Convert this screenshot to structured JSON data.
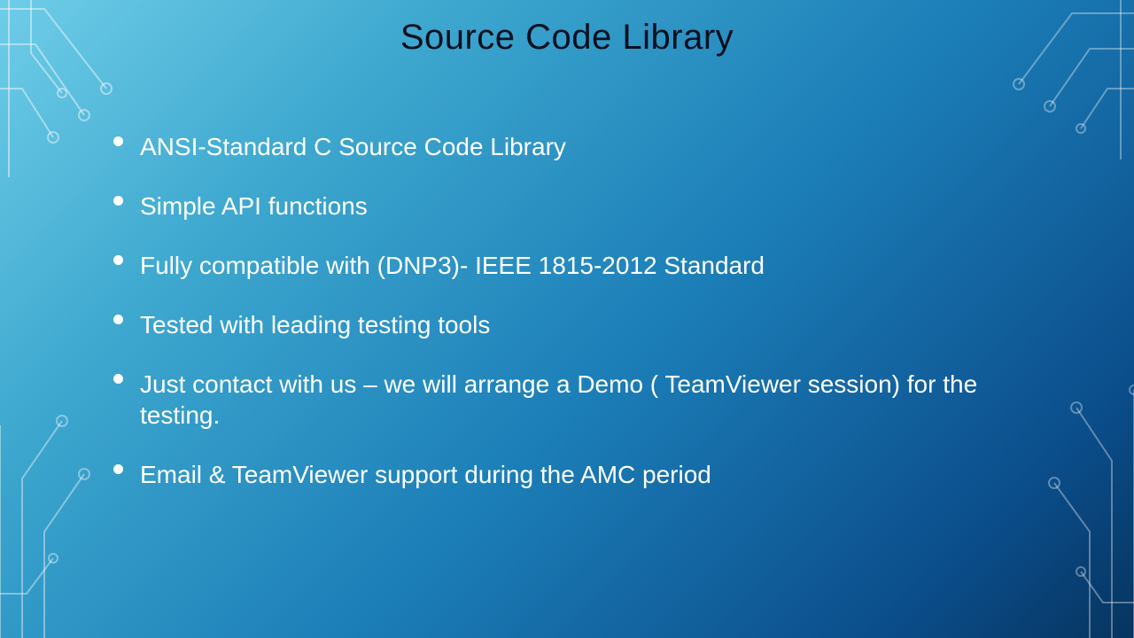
{
  "title": "Source Code Library",
  "bullets": [
    "ANSI-Standard C Source Code Library",
    "Simple API functions",
    "Fully compatible with (DNP3)- IEEE 1815-2012 Standard",
    "Tested with leading testing tools",
    "Just contact with us – we will arrange a Demo ( TeamViewer session) for the testing.",
    "Email & TeamViewer support during the AMC period"
  ]
}
